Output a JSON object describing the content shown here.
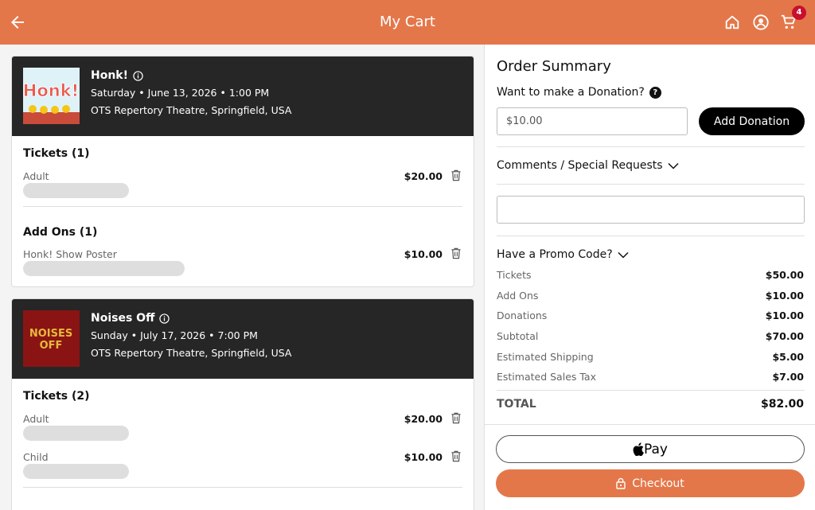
{
  "header": {
    "title": "My Cart",
    "cart_count": "4",
    "accent_color": "#e4774a"
  },
  "events": [
    {
      "name": "Honk!",
      "poster_text": "Honk!",
      "date": "Saturday • June 13, 2026 • 1:00 PM",
      "venue": "OTS Repertory Theatre, Springfield, USA",
      "tickets_title": "Tickets (1)",
      "tickets": [
        {
          "label": "Adult",
          "price": "$20.00"
        }
      ],
      "addons_title": "Add Ons (1)",
      "addons": [
        {
          "label": "Honk! Show Poster",
          "price": "$10.00"
        }
      ]
    },
    {
      "name": "Noises Off",
      "poster_text_1": "NOISES",
      "poster_text_2": "OFF",
      "date": "Sunday • July 17, 2026 • 7:00 PM",
      "venue": "OTS Repertory Theatre, Springfield, USA",
      "tickets_title": "Tickets (2)",
      "tickets": [
        {
          "label": "Adult",
          "price": "$20.00"
        },
        {
          "label": "Child",
          "price": "$10.00"
        }
      ]
    }
  ],
  "summary": {
    "title": "Order Summary",
    "donation_question": "Want to make a Donation?",
    "donation_placeholder": "$10.00",
    "add_donation_label": "Add Donation",
    "comments_label": "Comments / Special Requests",
    "promo_label": "Have a Promo Code?",
    "lines": [
      {
        "label": "Tickets",
        "value": "$50.00"
      },
      {
        "label": "Add Ons",
        "value": "$10.00"
      },
      {
        "label": "Donations",
        "value": "$10.00"
      },
      {
        "label": "Subtotal",
        "value": "$70.00"
      },
      {
        "label": "Estimated Shipping",
        "value": "$5.00"
      },
      {
        "label": "Estimated Sales Tax",
        "value": "$7.00"
      }
    ],
    "total_label": "TOTAL",
    "total_value": "$82.00",
    "apple_pay_label": "Pay",
    "checkout_label": "Checkout"
  }
}
